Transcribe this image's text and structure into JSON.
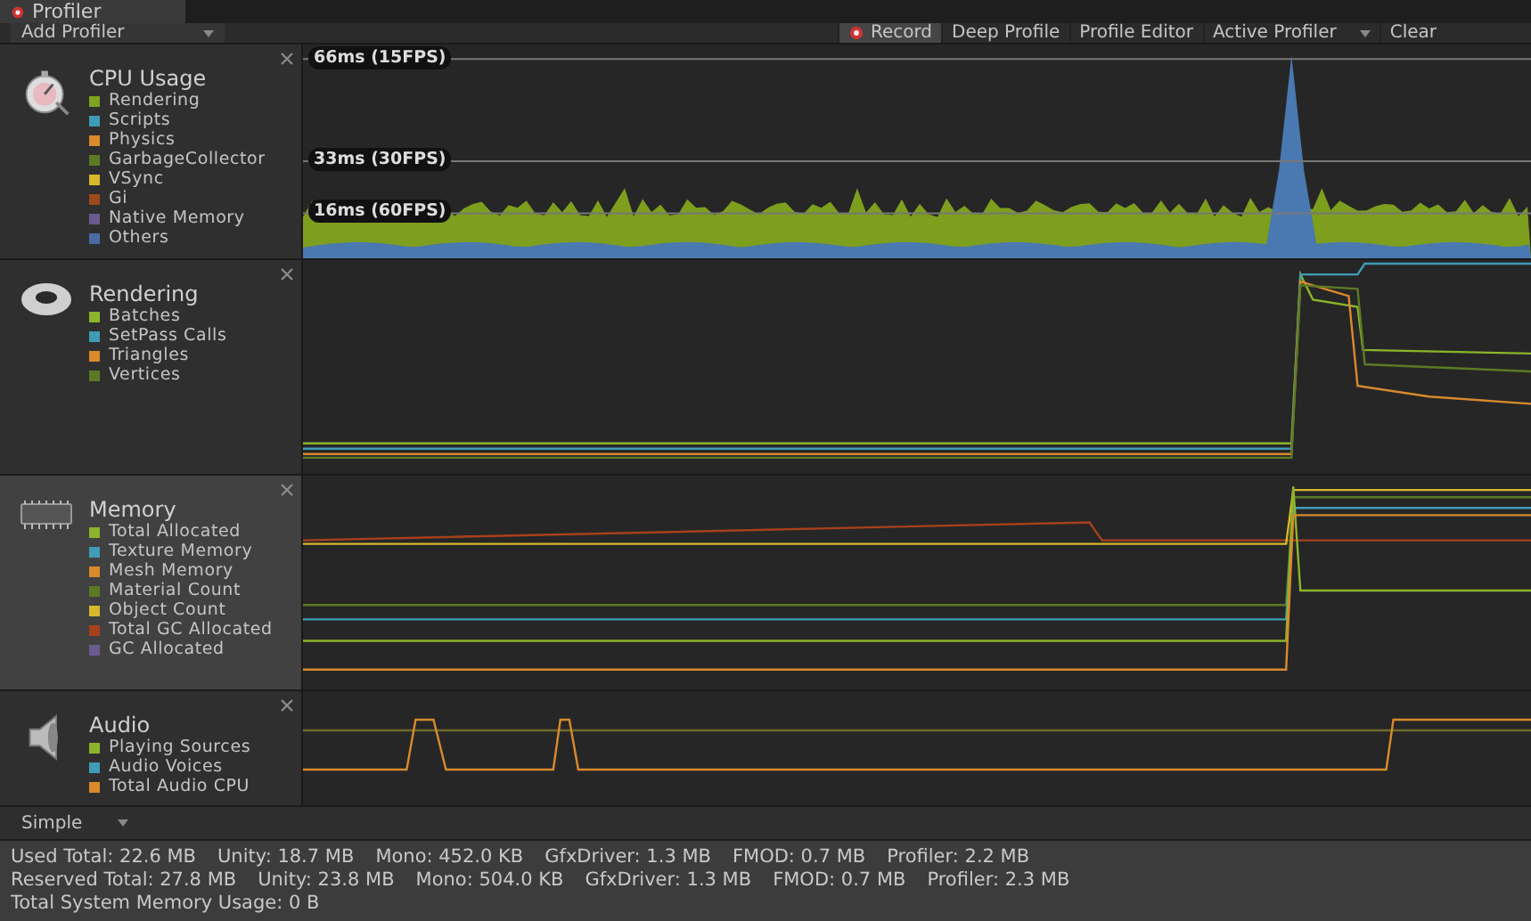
{
  "window": {
    "tab": "Profiler"
  },
  "toolbar": {
    "add_profiler": "Add Profiler",
    "buttons": [
      {
        "label": "Record",
        "kind": "record",
        "selected": true
      },
      {
        "label": "Deep Profile",
        "kind": "toggle",
        "selected": false
      },
      {
        "label": "Profile Editor",
        "kind": "toggle",
        "selected": false
      },
      {
        "label": "Active Profiler",
        "kind": "dropdown",
        "selected": false
      },
      {
        "label": "Clear",
        "kind": "toggle",
        "selected": false
      }
    ]
  },
  "modules": [
    {
      "title": "CPU Usage",
      "kind": "cpu",
      "selected": false,
      "thresholds": [
        "66ms (15FPS)",
        "33ms (30FPS)",
        "16ms (60FPS)"
      ],
      "legend": [
        {
          "label": "Rendering",
          "color": "#7ea420"
        },
        {
          "label": "Scripts",
          "color": "#3f9cb7"
        },
        {
          "label": "Physics",
          "color": "#d98a2c"
        },
        {
          "label": "GarbageCollector",
          "color": "#5c7a24"
        },
        {
          "label": "VSync",
          "color": "#d6b82b"
        },
        {
          "label": "Gi",
          "color": "#9c4a1c"
        },
        {
          "label": "Native Memory",
          "color": "#6a5a8e"
        },
        {
          "label": "Others",
          "color": "#4a6aa6"
        }
      ]
    },
    {
      "title": "Rendering",
      "kind": "rendering",
      "selected": false,
      "legend": [
        {
          "label": "Batches",
          "color": "#8cb42a"
        },
        {
          "label": "SetPass Calls",
          "color": "#3f9cb7"
        },
        {
          "label": "Triangles",
          "color": "#d98a2c"
        },
        {
          "label": "Vertices",
          "color": "#5c7a24"
        }
      ]
    },
    {
      "title": "Memory",
      "kind": "memory",
      "selected": true,
      "legend": [
        {
          "label": "Total Allocated",
          "color": "#8cb42a"
        },
        {
          "label": "Texture Memory",
          "color": "#3f9cb7"
        },
        {
          "label": "Mesh Memory",
          "color": "#d98a2c"
        },
        {
          "label": "Material Count",
          "color": "#5c7a24"
        },
        {
          "label": "Object Count",
          "color": "#d6b82b"
        },
        {
          "label": "Total GC Allocated",
          "color": "#a8401c"
        },
        {
          "label": "GC Allocated",
          "color": "#6a5a8e"
        }
      ]
    },
    {
      "title": "Audio",
      "kind": "audio",
      "selected": false,
      "legend": [
        {
          "label": "Playing Sources",
          "color": "#8cb42a"
        },
        {
          "label": "Audio Voices",
          "color": "#3f9cb7"
        },
        {
          "label": "Total Audio CPU",
          "color": "#d98a2c"
        }
      ]
    }
  ],
  "detail_mode": "Simple",
  "stats": [
    [
      "Used Total: 22.6 MB",
      "Unity: 18.7 MB",
      "Mono: 452.0 KB",
      "GfxDriver: 1.3 MB",
      "FMOD: 0.7 MB",
      "Profiler: 2.2 MB"
    ],
    [
      "Reserved Total: 27.8 MB",
      "Unity: 23.8 MB",
      "Mono: 504.0 KB",
      "GfxDriver: 1.3 MB",
      "FMOD: 0.7 MB",
      "Profiler: 2.3 MB"
    ],
    [
      "Total System Memory Usage: 0 B"
    ]
  ]
}
